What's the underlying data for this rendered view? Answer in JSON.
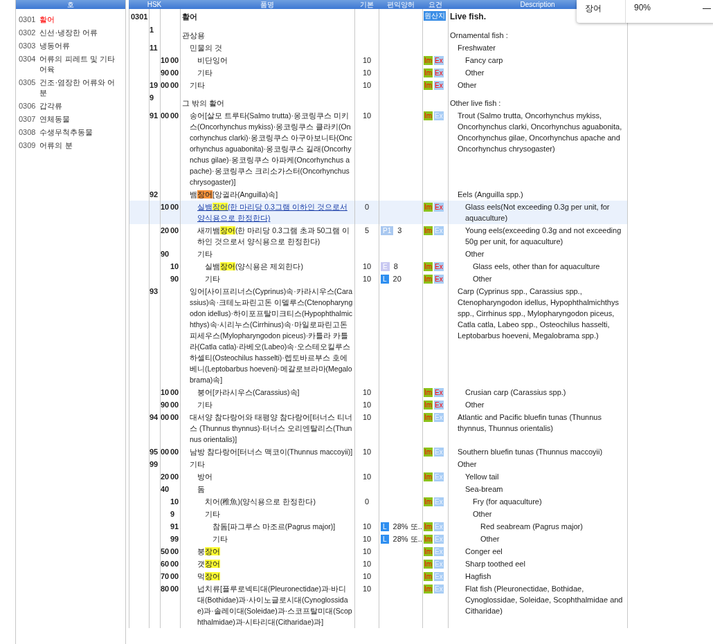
{
  "sidebar": {
    "header": "호",
    "items": [
      {
        "code": "0301",
        "name": "활어",
        "selected": true
      },
      {
        "code": "0302",
        "name": "신선·냉장한 어류",
        "selected": false
      },
      {
        "code": "0303",
        "name": "냉동어류",
        "selected": false
      },
      {
        "code": "0304",
        "name": "어류의 피레트 및 기타 어육",
        "selected": false
      },
      {
        "code": "0305",
        "name": "건조·염장한 어류와 어분",
        "selected": false
      },
      {
        "code": "0306",
        "name": "갑각류",
        "selected": false
      },
      {
        "code": "0307",
        "name": "연체동물",
        "selected": false
      },
      {
        "code": "0308",
        "name": "수생무척추동물",
        "selected": false
      },
      {
        "code": "0309",
        "name": "어류의 분",
        "selected": false
      }
    ]
  },
  "table": {
    "columns": [
      "HSK",
      "품명",
      "기본",
      "편익양허",
      "요건",
      "Description"
    ],
    "rows": [
      {
        "heading": "0301",
        "name": "활어",
        "badge": "원산지",
        "description": "Live fish.",
        "selected": false,
        "children": [
          {
            "hs1": "1",
            "name": "관상용",
            "description": "Ornamental fish :",
            "selected": false,
            "children": [
              {
                "hs1": "11",
                "name": "민물의 것",
                "description": "Freshwater",
                "selected": false,
                "children": [
                  {
                    "hs2": "10",
                    "hs3": "00",
                    "name": "비단잉어",
                    "basic": "10",
                    "requirements": [
                      {
                        "label": "Im",
                        "color": "#8cc21a",
                        "active": true
                      },
                      {
                        "label": "Ex",
                        "color": "#a8cdf5",
                        "active": true
                      }
                    ],
                    "description": "Fancy carp",
                    "selected": false
                  },
                  {
                    "hs2": "90",
                    "hs3": "00",
                    "name": "기타",
                    "basic": "10",
                    "requirements": [
                      {
                        "label": "Im",
                        "color": "#8cc21a",
                        "active": true
                      },
                      {
                        "label": "Ex",
                        "color": "#a8cdf5",
                        "active": true
                      }
                    ],
                    "description": "Other",
                    "selected": false
                  }
                ]
              },
              {
                "hs1": "19",
                "hs2": "00",
                "hs3": "00",
                "name": "기타",
                "basic": "10",
                "requirements": [
                  {
                    "label": "Im",
                    "color": "#8cc21a",
                    "active": true
                  },
                  {
                    "label": "Ex",
                    "color": "#a8cdf5",
                    "active": true
                  }
                ],
                "description": "Other",
                "selected": false
              }
            ]
          },
          {
            "hs1": "9",
            "name": "그 밖의 활어",
            "description": "Other live fish :",
            "selected": false,
            "children": [
              {
                "hs1": "91",
                "hs2": "00",
                "hs3": "00",
                "name": "송어[살모 트루타(Salmo trutta)·옹코링쿠스 미키스(Oncorhynchus mykiss)·옹코링쿠스 클라키(Oncorhynchus clarki)·옹코링쿠스 아구아보니타(Oncorhynchus aguabonita)·옹코링쿠스 길래(Oncorhynchus gilae)·옹코링쿠스 아파케(Oncorhynchus apache)·옹코링쿠스 크리소가스터(Oncorhynchus chrysogaster)]",
                "basic": "10",
                "requirements": [
                  {
                    "label": "Im",
                    "color": "#8cc21a",
                    "active": true
                  },
                  {
                    "label": "Ex",
                    "color": "#a8cdf5",
                    "active": false
                  }
                ],
                "description": "Trout (Salmo trutta, Oncorhynchus mykiss, Oncorhynchus clarki, Oncorhynchus aguabonita, Oncorhynchus gilae, Oncorhynchus apache and Oncorhynchus chrysogaster)",
                "selected": false
              },
              {
                "hs1": "92",
                "name_segments": [
                  {
                    "text": "뱀"
                  },
                  {
                    "text": "장어",
                    "match": true,
                    "current": true
                  },
                  {
                    "text": "[앙귈라(Anguilla)속]"
                  }
                ],
                "description": "Eels (Anguilla spp.)",
                "selected": false,
                "children": [
                  {
                    "hs2": "10",
                    "hs3": "00",
                    "name_segments": [
                      {
                        "text": "실뱀"
                      },
                      {
                        "text": "장어",
                        "match": true,
                        "current": false
                      },
                      {
                        "text": "(한 마리당 0.3그램 이하인 것으로서 양식용으로 한정한다)"
                      }
                    ],
                    "basic": "0",
                    "requirements": [
                      {
                        "label": "Im",
                        "color": "#8cc21a",
                        "active": true
                      },
                      {
                        "label": "Ex",
                        "color": "#a8cdf5",
                        "active": true
                      }
                    ],
                    "description": "Glass eels(Not exceeding 0.3g per unit, for aquaculture)",
                    "selected": true
                  },
                  {
                    "hs2": "20",
                    "hs3": "00",
                    "name_segments": [
                      {
                        "text": "새끼뱀"
                      },
                      {
                        "text": "장어",
                        "match": true,
                        "current": false
                      },
                      {
                        "text": "(한 마리당 0.3그램 초과 50그램 이하인 것으로서 양식용으로 한정한다)"
                      }
                    ],
                    "basic": "5",
                    "rate": {
                      "tag": "P1",
                      "color": "#a9c8f0",
                      "value": "3"
                    },
                    "requirements": [
                      {
                        "label": "Im",
                        "color": "#8cc21a",
                        "active": true
                      },
                      {
                        "label": "Ex",
                        "color": "#a8cdf5",
                        "active": false
                      }
                    ],
                    "description": "Young eels(exceeding 0.3g and not exceeding 50g per unit, for aquaculture)",
                    "selected": false
                  },
                  {
                    "hs2": "90",
                    "name": "기타",
                    "description": "Other",
                    "selected": false,
                    "children": [
                      {
                        "hs3": "10",
                        "name_segments": [
                          {
                            "text": "실뱀"
                          },
                          {
                            "text": "장어",
                            "match": true,
                            "current": false
                          },
                          {
                            "text": "(양식용은 제외한다)"
                          }
                        ],
                        "basic": "10",
                        "rate": {
                          "tag": "E",
                          "color": "#c9c9f2",
                          "value": "8"
                        },
                        "requirements": [
                          {
                            "label": "Im",
                            "color": "#8cc21a",
                            "active": true
                          },
                          {
                            "label": "Ex",
                            "color": "#a8cdf5",
                            "active": true
                          }
                        ],
                        "description": "Glass eels, other than for aquaculture",
                        "selected": false
                      },
                      {
                        "hs3": "90",
                        "name": "기타",
                        "basic": "10",
                        "rate": {
                          "tag": "L",
                          "color": "#2f8ff0",
                          "value": "20"
                        },
                        "requirements": [
                          {
                            "label": "Im",
                            "color": "#8cc21a",
                            "active": true
                          },
                          {
                            "label": "Ex",
                            "color": "#a8cdf5",
                            "active": true
                          }
                        ],
                        "description": "Other",
                        "selected": false
                      }
                    ]
                  }
                ]
              },
              {
                "hs1": "93",
                "name": "잉어[사이프리너스(Cyprinus)속·카라시우스(Carassius)속·크테노파린고돈 이델루스(Ctenopharyngodon idellus)·하이포프탈미크티스(Hypophthalmichthys)속·시리누스(Cirrhinus)속·마일로파린고돈 피세우스(Mylopharyngodon piceus)·카틀라 카틀라(Catla catla)·라베오(Labeo)속·오스테오킬루스 하셀티(Osteochilus hasselti)·렙토바르부스 호에베니(Leptobarbus hoeveni)·메갈로브라마(Megalobrama)속]",
                "description": "Carp (Cyprinus spp., Carassius spp., Ctenopharyngodon idellus, Hypophthalmichthys spp., Cirrhinus spp., Mylopharyngodon piceus, Catla catla, Labeo spp., Osteochilus hasselti, Leptobarbus hoeveni, Megalobrama spp.)",
                "selected": false,
                "children": [
                  {
                    "hs2": "10",
                    "hs3": "00",
                    "name": "붕어[카라시우스(Carassius)속]",
                    "basic": "10",
                    "requirements": [
                      {
                        "label": "Im",
                        "color": "#8cc21a",
                        "active": true
                      },
                      {
                        "label": "Ex",
                        "color": "#a8cdf5",
                        "active": true
                      }
                    ],
                    "description": "Crusian carp (Carassius spp.)",
                    "selected": false
                  },
                  {
                    "hs2": "90",
                    "hs3": "00",
                    "name": "기타",
                    "basic": "10",
                    "requirements": [
                      {
                        "label": "Im",
                        "color": "#8cc21a",
                        "active": true
                      },
                      {
                        "label": "Ex",
                        "color": "#a8cdf5",
                        "active": true
                      }
                    ],
                    "description": "Other",
                    "selected": false
                  }
                ]
              },
              {
                "hs1": "94",
                "hs2": "00",
                "hs3": "00",
                "name": "대서양 참다랑어와 태평양 참다랑어[터너스 티너스 (Thunnus thynnus)·터너스 오리엔탈리스(Thunnus orientalis)]",
                "basic": "10",
                "requirements": [
                  {
                    "label": "Im",
                    "color": "#8cc21a",
                    "active": true
                  },
                  {
                    "label": "Ex",
                    "color": "#a8cdf5",
                    "active": false
                  }
                ],
                "description": "Atlantic and Pacific bluefin tunas (Thunnus thynnus, Thunnus orientalis)",
                "selected": false
              },
              {
                "hs1": "95",
                "hs2": "00",
                "hs3": "00",
                "name": "남방 참다랑어[터너스 맥코이(Thunnus maccoyii)]",
                "basic": "10",
                "requirements": [
                  {
                    "label": "Im",
                    "color": "#8cc21a",
                    "active": true
                  },
                  {
                    "label": "Ex",
                    "color": "#a8cdf5",
                    "active": false
                  }
                ],
                "description": "Southern bluefin tunas (Thunnus maccoyii)",
                "selected": false
              },
              {
                "hs1": "99",
                "name": "기타",
                "description": "Other",
                "selected": false,
                "children": [
                  {
                    "hs2": "20",
                    "hs3": "00",
                    "name": "방어",
                    "basic": "10",
                    "requirements": [
                      {
                        "label": "Im",
                        "color": "#8cc21a",
                        "active": true
                      },
                      {
                        "label": "Ex",
                        "color": "#a8cdf5",
                        "active": false
                      }
                    ],
                    "description": "Yellow tail",
                    "selected": false
                  },
                  {
                    "hs2": "40",
                    "name": "돔",
                    "description": "Sea-bream",
                    "selected": false,
                    "children": [
                      {
                        "hs3": "10",
                        "name": "치어(稚魚)(양식용으로 한정한다)",
                        "basic": "0",
                        "requirements": [
                          {
                            "label": "Im",
                            "color": "#8cc21a",
                            "active": true
                          },
                          {
                            "label": "Ex",
                            "color": "#a8cdf5",
                            "active": false
                          }
                        ],
                        "description": "Fry (for aquaculture)",
                        "selected": false
                      },
                      {
                        "hs3": "9",
                        "name": "기타",
                        "description": "Other",
                        "selected": false,
                        "children": [
                          {
                            "hs3": "91",
                            "name": "참돔[파그루스 마조르(Pagrus major)]",
                            "basic": "10",
                            "rate": {
                              "tag": "L",
                              "color": "#2f8ff0",
                              "value": "28% 또.."
                            },
                            "requirements": [
                              {
                                "label": "Im",
                                "color": "#8cc21a",
                                "active": true
                              },
                              {
                                "label": "Ex",
                                "color": "#a8cdf5",
                                "active": false
                              }
                            ],
                            "description": "Red seabream (Pagrus major)",
                            "selected": false
                          },
                          {
                            "hs3": "99",
                            "name": "기타",
                            "basic": "10",
                            "rate": {
                              "tag": "L",
                              "color": "#2f8ff0",
                              "value": "28% 또.."
                            },
                            "requirements": [
                              {
                                "label": "Im",
                                "color": "#8cc21a",
                                "active": true
                              },
                              {
                                "label": "Ex",
                                "color": "#a8cdf5",
                                "active": false
                              }
                            ],
                            "description": "Other",
                            "selected": false
                          }
                        ]
                      }
                    ]
                  },
                  {
                    "hs2": "50",
                    "hs3": "00",
                    "name_segments": [
                      {
                        "text": "붕"
                      },
                      {
                        "text": "장어",
                        "match": true,
                        "current": false
                      }
                    ],
                    "basic": "10",
                    "requirements": [
                      {
                        "label": "Im",
                        "color": "#8cc21a",
                        "active": true
                      },
                      {
                        "label": "Ex",
                        "color": "#a8cdf5",
                        "active": false
                      }
                    ],
                    "description": "Conger eel",
                    "selected": false
                  },
                  {
                    "hs2": "60",
                    "hs3": "00",
                    "name_segments": [
                      {
                        "text": "갯"
                      },
                      {
                        "text": "장어",
                        "match": true,
                        "current": false
                      }
                    ],
                    "basic": "10",
                    "requirements": [
                      {
                        "label": "Im",
                        "color": "#8cc21a",
                        "active": true
                      },
                      {
                        "label": "Ex",
                        "color": "#a8cdf5",
                        "active": false
                      }
                    ],
                    "description": "Sharp toothed eel",
                    "selected": false
                  },
                  {
                    "hs2": "70",
                    "hs3": "00",
                    "name_segments": [
                      {
                        "text": "먹"
                      },
                      {
                        "text": "장어",
                        "match": true,
                        "current": false
                      }
                    ],
                    "basic": "10",
                    "requirements": [
                      {
                        "label": "Im",
                        "color": "#8cc21a",
                        "active": true
                      },
                      {
                        "label": "Ex",
                        "color": "#a8cdf5",
                        "active": false
                      }
                    ],
                    "description": "Hagfish",
                    "selected": false
                  },
                  {
                    "hs2": "80",
                    "hs3": "00",
                    "name": "넙치류[플루로넥티대(Pleuronectidae)과·바디대(Bothidae)과·사이노글로시대(Cynoglossidae)과·솔레이대(Soleidae)과·스코프탈미대(Scophthalmidae)과·시타리대(Citharidae)과]",
                    "basic": "10",
                    "requirements": [
                      {
                        "label": "Im",
                        "color": "#8cc21a",
                        "active": true
                      },
                      {
                        "label": "Ex",
                        "color": "#a8cdf5",
                        "active": false
                      }
                    ],
                    "description": "Flat fish (Pleuronectidae, Bothidae, Cynoglossidae, Soleidae, Scophthalmidae and Citharidae)",
                    "selected": false
                  }
                ]
              }
            ]
          }
        ]
      }
    ]
  },
  "find_popup": {
    "query": "장어",
    "zoom": "90%",
    "zoom_out": "—"
  }
}
